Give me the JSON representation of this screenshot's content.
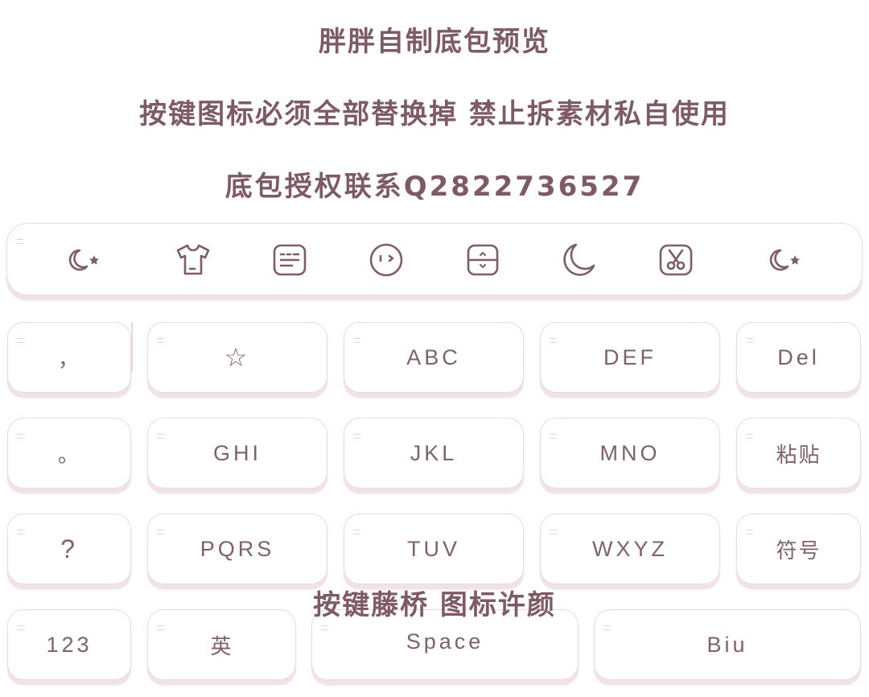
{
  "header": {
    "title": "胖胖自制底包预览",
    "notice": "按键图标必须全部替换掉 禁止拆素材私自使用",
    "contact": "底包授权联系Q2822736527"
  },
  "toolbar": {
    "icons": [
      "moon-star-icon",
      "shirt-icon",
      "keyboard-icon",
      "emoji-face-icon",
      "clipboard-icon",
      "moon-icon",
      "scissors-icon",
      "moon-star-icon"
    ]
  },
  "keys": {
    "comma": "，",
    "star": "☆",
    "abc": "ABC",
    "def": "DEF",
    "del": "Del",
    "period": "。",
    "ghi": "GHI",
    "jkl": "JKL",
    "mno": "MNO",
    "paste": "粘贴",
    "question": "?",
    "pqrs": "PQRS",
    "tuv": "TUV",
    "wxyz": "WXYZ",
    "symbols": "符号",
    "num": "123",
    "english": "英",
    "space": "Space",
    "biu": "Biu"
  },
  "credit": "按键藤桥  图标许颜"
}
